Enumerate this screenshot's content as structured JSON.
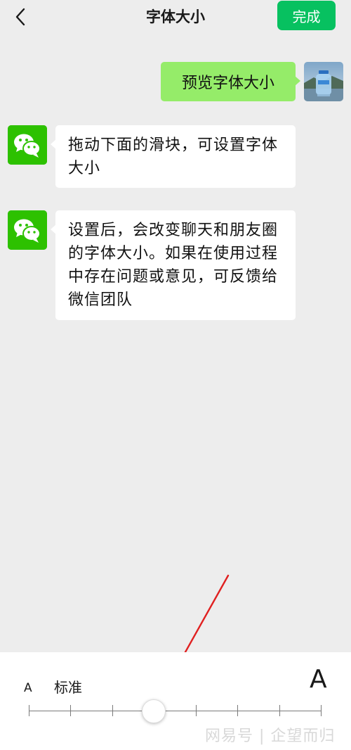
{
  "header": {
    "title": "字体大小",
    "done_label": "完成"
  },
  "messages": {
    "sent": "预览字体大小",
    "received": [
      "拖动下面的滑块，可设置字体大小",
      "设置后，会改变聊天和朋友圈的字体大小。如果在使用过程中存在问题或意见，可反馈给微信团队"
    ]
  },
  "font_size_panel": {
    "small_label": "A",
    "current_label": "标准",
    "large_label": "A",
    "steps": 8,
    "selected_step": 3
  },
  "watermark": "网易号 | 企望而归",
  "colors": {
    "accent": "#07c160",
    "sent_bubble": "#95ec69",
    "background": "#ededed",
    "annotation_arrow": "#e02020"
  },
  "icons": {
    "back": "chevron-left-icon",
    "bot_avatar": "wechat-logo-icon"
  }
}
